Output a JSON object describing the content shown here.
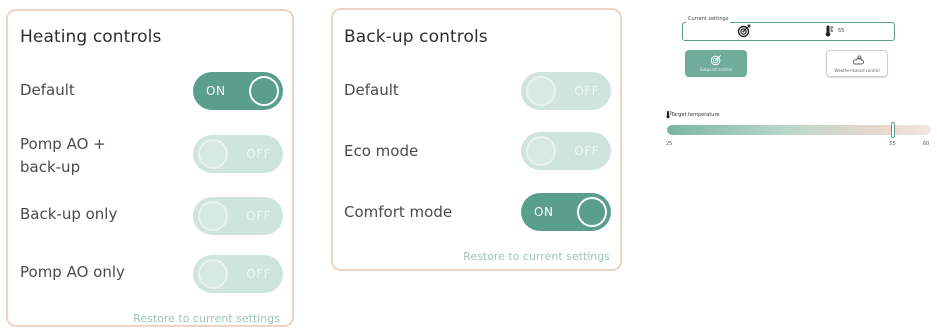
{
  "heating": {
    "title": "Heating controls",
    "rows": [
      {
        "label": "Default",
        "state": "ON"
      },
      {
        "label": "Pomp AO +",
        "label2": "back-up",
        "state": "OFF"
      },
      {
        "label": "Back-up only",
        "state": "OFF"
      },
      {
        "label": "Pomp AO only",
        "state": "OFF"
      }
    ],
    "restore_label": "Restore to current settings"
  },
  "backup": {
    "title": "Back-up controls",
    "rows": [
      {
        "label": "Default",
        "state": "OFF"
      },
      {
        "label": "Eco mode",
        "state": "OFF"
      },
      {
        "label": "Comfort mode",
        "state": "ON"
      }
    ],
    "restore_label": "Restore to current settings"
  },
  "current_settings": {
    "legend": "Current settings",
    "mode_icon": "target-icon",
    "temp_icon": "thermometer-icon",
    "temperature": "55"
  },
  "modes": [
    {
      "label": "Setpoint control",
      "icon": "target-icon",
      "active": true
    },
    {
      "label": "Weather-based control",
      "icon": "cloud-sun-icon",
      "active": false
    }
  ],
  "target_temperature": {
    "label": "Target temperature",
    "icon": "thermometer-icon",
    "min": "25",
    "value": "55",
    "max": "60",
    "value_num": 55,
    "min_num": 25,
    "max_num": 60
  },
  "colors": {
    "accent": "#5a9e8c",
    "toggle_off": "#cfe4dc",
    "card_border": "#efd3c6",
    "link": "#9cc5b7"
  }
}
